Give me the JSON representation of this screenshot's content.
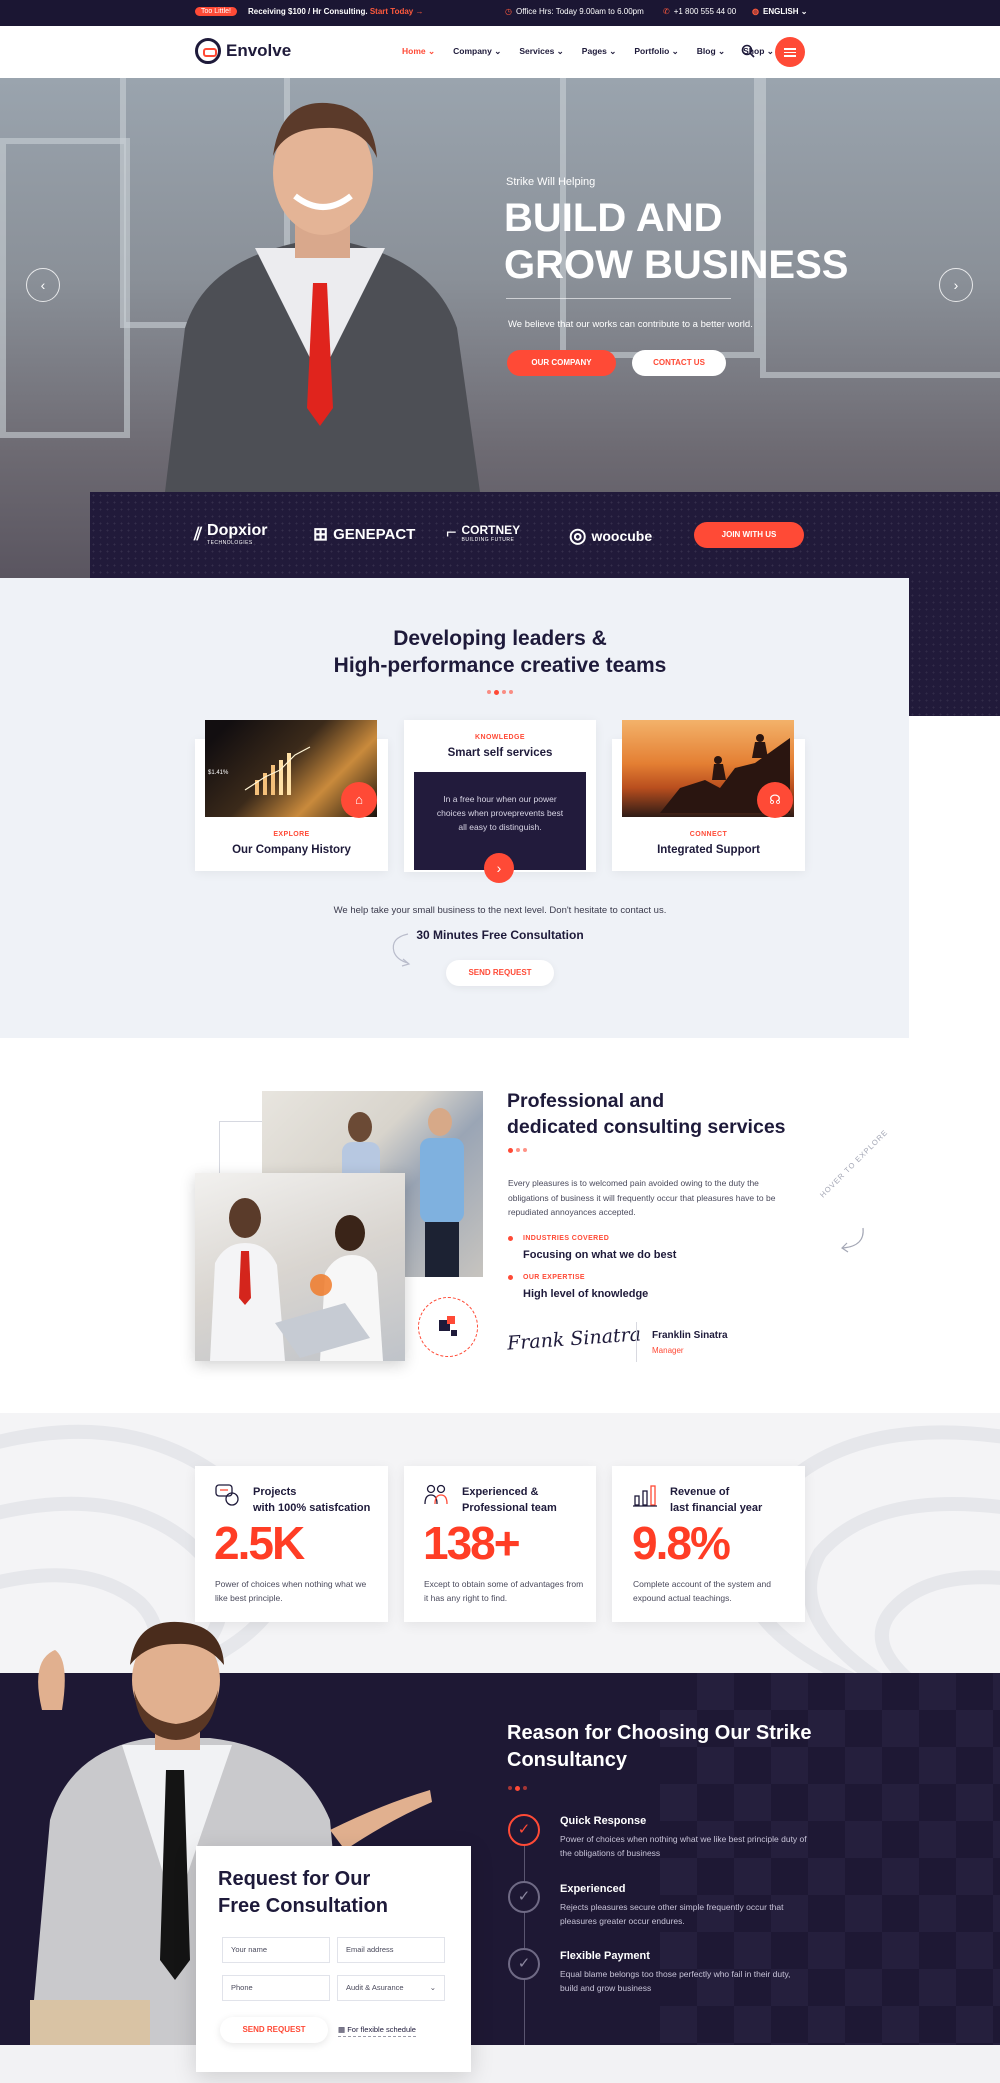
{
  "topbar": {
    "badge": "Too Little!",
    "promo": "Receiving $100 / Hr Consulting.",
    "promo_link": "Start Today",
    "hours": "Office Hrs: Today 9.00am to 6.00pm",
    "phone": "+1 800 555 44 00",
    "language": "ENGLISH"
  },
  "header": {
    "logo": "Envolve",
    "nav": [
      "Home",
      "Company",
      "Services",
      "Pages",
      "Portfolio",
      "Blog",
      "Shop"
    ]
  },
  "hero": {
    "subtitle": "Strike Will Helping",
    "title_line1": "BUILD AND",
    "title_line2": "GROW BUSINESS",
    "description": "We believe that our works can contribute to a better world.",
    "btn_primary": "OUR COMPANY",
    "btn_secondary": "CONTACT US"
  },
  "partners": {
    "logos": [
      {
        "name": "Dopxior",
        "tag": "TECHNOLOGIES"
      },
      {
        "name": "GENEPACT",
        "tag": ""
      },
      {
        "name": "CORTNEY",
        "tag": "BUILDING FUTURE"
      },
      {
        "name": "woocube",
        "tag": ""
      }
    ],
    "cta": "JOIN WITH US"
  },
  "leaders": {
    "title_line1": "Developing leaders &",
    "title_line2": "High-performance creative teams",
    "cards": [
      {
        "kicker": "EXPLORE",
        "title": "Our Company History",
        "chart_label": "$1.41%"
      },
      {
        "kicker": "KNOWLEDGE",
        "title": "Smart self services",
        "text": "In a free hour when our power choices when proveprevents best all easy to distinguish."
      },
      {
        "kicker": "CONNECT",
        "title": "Integrated Support"
      }
    ],
    "note": "We help take your small business to the next level. Don't hesitate to contact us.",
    "consult": "30 Minutes Free Consultation",
    "button": "SEND REQUEST"
  },
  "consulting": {
    "title_line1": "Professional and",
    "title_line2": "dedicated consulting services",
    "text": "Every pleasures is to welcomed pain avoided owing to the duty the obligations of business it will frequently occur that pleasures have to be repudiated annoyances accepted.",
    "features": [
      {
        "kicker": "INDUSTRIES COVERED",
        "title": "Focusing on what we do best"
      },
      {
        "kicker": "OUR EXPERTISE",
        "title": "High level of knowledge"
      }
    ],
    "signature": "Frank Sinatra",
    "person_name": "Franklin Sinatra",
    "person_role": "Manager",
    "hover_hint": "HOVER TO EXPLORE"
  },
  "stats": [
    {
      "title_line1": "Projects",
      "title_line2": "with 100% satisfcation",
      "number": "2.5K",
      "text": "Power of choices when nothing what we like best principle."
    },
    {
      "title_line1": "Experienced &",
      "title_line2": "Professional team",
      "number": "138+",
      "text": "Except to obtain some of advantages from it has any right to find."
    },
    {
      "title_line1": "Revenue of",
      "title_line2": "last financial year",
      "number": "9.8%",
      "text": "Complete account of the system and expound actual teachings."
    }
  ],
  "reason": {
    "title_line1": "Reason for Choosing Our Strike",
    "title_line2": "Consultancy",
    "items": [
      {
        "title": "Quick Response",
        "text": "Power of choices when nothing what we like best principle duty of the obligations of business"
      },
      {
        "title": "Experienced",
        "text": "Rejects pleasures secure other simple frequently occur that pleasures greater occur endures."
      },
      {
        "title": "Flexible Payment",
        "text": "Equal blame belongs too those perfectly who fail in their duty, build and grow business"
      }
    ]
  },
  "form": {
    "title_line1": "Request for Our",
    "title_line2": "Free Consultation",
    "name_placeholder": "Your name",
    "email_placeholder": "Email address",
    "phone_placeholder": "Phone",
    "service_value": "Audit & Asurance",
    "button": "SEND REQUEST",
    "schedule": "For flexible schedule"
  },
  "colors": {
    "accent": "#ff4a36",
    "dark": "#1e1834"
  }
}
